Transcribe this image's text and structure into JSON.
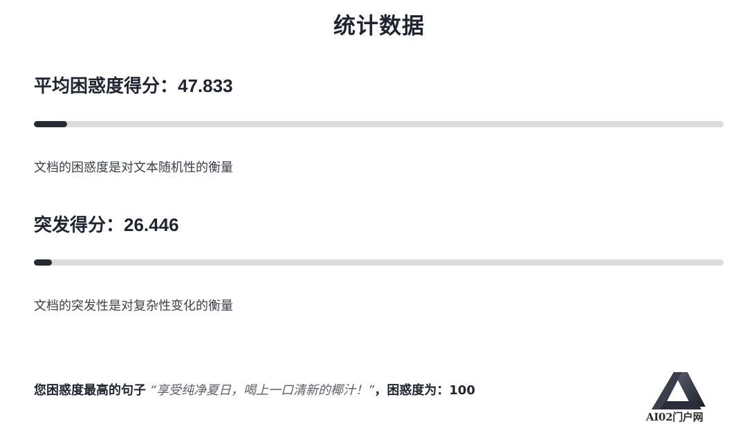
{
  "page": {
    "title": "统计数据"
  },
  "perplexity": {
    "label": "平均困惑度得分：",
    "value": "47.833",
    "progress_fraction": 0.048,
    "description": "文档的困惑度是对文本随机性的衡量"
  },
  "burstiness": {
    "label": "突发得分：",
    "value": "26.446",
    "progress_fraction": 0.026,
    "description": "文档的突发性是对复杂性变化的衡量"
  },
  "highest_sentence": {
    "prefix": "您困惑度最高的句子",
    "sentence": "“享受纯净夏日，喝上一口清新的椰汁！”",
    "suffix_label": "，困惑度为：",
    "score": "100"
  },
  "watermark": {
    "text": "AI02门户网",
    "icon": "ai02-logo-icon"
  },
  "colors": {
    "bar_fill": "#262a33",
    "bar_track": "#dcdcdc",
    "heading_text": "#1f2430"
  }
}
